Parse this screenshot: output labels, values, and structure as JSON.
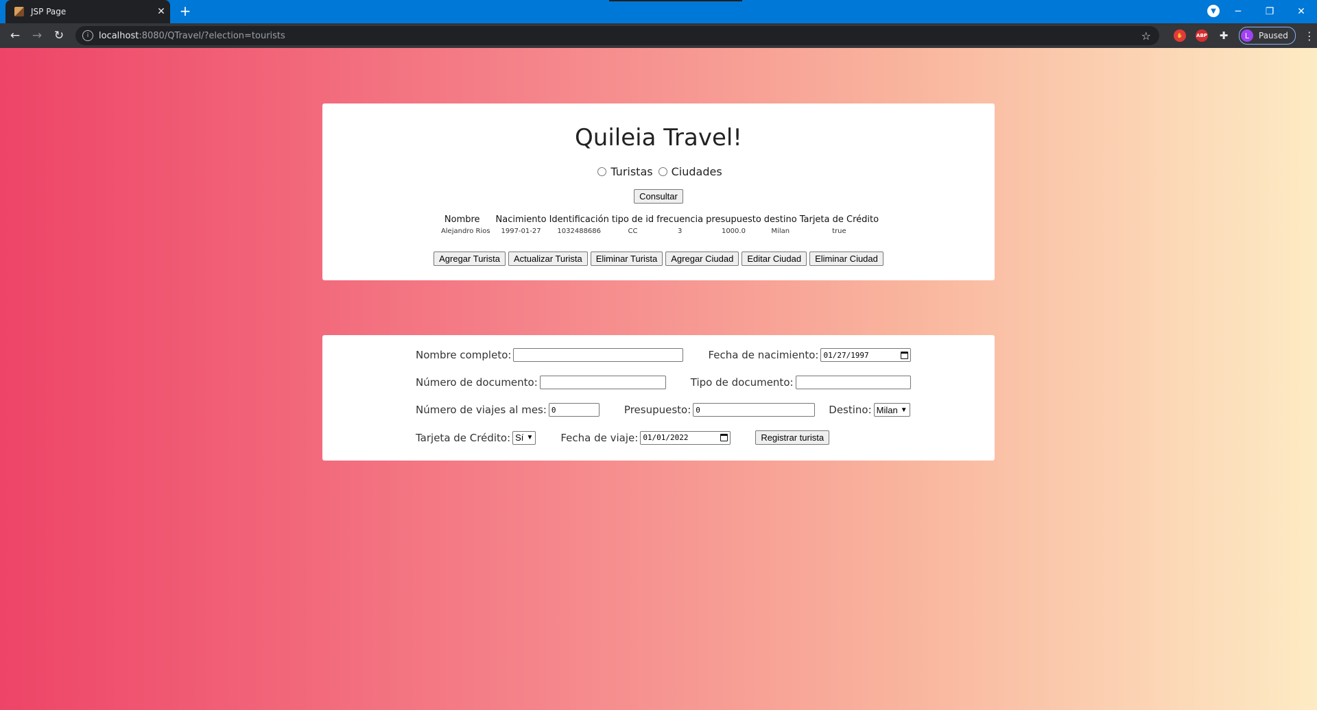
{
  "browser": {
    "tab_title": "JSP Page",
    "url_host": "localhost",
    "url_rest": ":8080/QTravel/?election=tourists",
    "profile_initial": "L",
    "profile_status": "Paused",
    "ext_abp": "ABP"
  },
  "page": {
    "title": "Quileia Travel!",
    "radio_tourists": "Turistas",
    "radio_cities": "Ciudades",
    "consult_button": "Consultar",
    "table": {
      "headers": [
        "Nombre",
        "Nacimiento",
        "Identificación",
        "tipo de id",
        "frecuencia",
        "presupuesto",
        "destino",
        "Tarjeta de Crédito"
      ],
      "rows": [
        [
          "Alejandro Rios",
          "1997-01-27",
          "1032488686",
          "CC",
          "3",
          "1000.0",
          "Milan",
          "true"
        ]
      ]
    },
    "actions": {
      "add_tourist": "Agregar Turista",
      "update_tourist": "Actualizar Turista",
      "delete_tourist": "Eliminar Turista",
      "add_city": "Agregar Ciudad",
      "edit_city": "Editar Ciudad",
      "delete_city": "Eliminar Ciudad"
    }
  },
  "form": {
    "full_name_label": "Nombre completo:",
    "full_name_value": "",
    "birth_date_label": "Fecha de nacimiento:",
    "birth_date_value": "01/27/1997",
    "doc_number_label": "Número de documento:",
    "doc_number_value": "",
    "doc_type_label": "Tipo de documento:",
    "doc_type_value": "",
    "trips_label": "Número de viajes al mes:",
    "trips_value": "0",
    "budget_label": "Presupuesto:",
    "budget_value": "0",
    "destination_label": "Destino:",
    "destination_value": "Milan",
    "credit_card_label": "Tarjeta de Crédito:",
    "credit_card_value": "Sí",
    "trip_date_label": "Fecha de viaje:",
    "trip_date_value": "01/01/2022",
    "register_button": "Registrar turista"
  }
}
